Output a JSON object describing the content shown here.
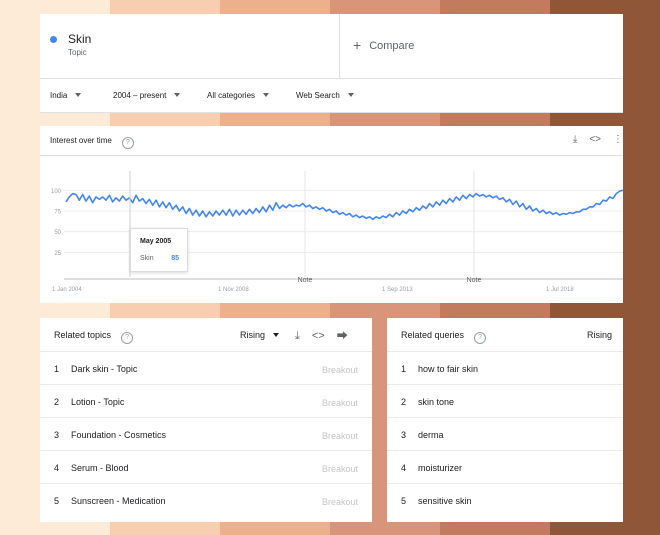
{
  "colors": {
    "accent": "#4285f4",
    "bands": [
      "#fdebd7",
      "#f8ceb0",
      "#ecb08d",
      "#d8957a",
      "#c37b60",
      "#8f5638"
    ]
  },
  "header": {
    "term_name": "Skin",
    "term_type": "Topic",
    "compare_label": "Compare",
    "compare_icon": "plus-icon"
  },
  "filters": {
    "region": "India",
    "period": "2004 – present",
    "category": "All categories",
    "search_type": "Web Search"
  },
  "interest": {
    "title": "Interest over time",
    "help_icon": "question-circle-icon",
    "icons": [
      "download-icon",
      "embed-code-icon",
      "more-icon"
    ],
    "chart_data": {
      "type": "line",
      "title": "Interest over time",
      "y_ticks": [
        100,
        75,
        50,
        25
      ],
      "ylim": [
        0,
        100
      ],
      "x_tick_labels": [
        "1 Jan 2004",
        "1 Nov 2008",
        "1 Sep 2013",
        "1 Jul 2018"
      ],
      "annotations": [
        "Note",
        "Note"
      ],
      "grid": true,
      "series": [
        {
          "name": "Skin",
          "color": "#4285f4",
          "values": [
            86,
            92,
            96,
            95,
            88,
            95,
            87,
            93,
            85,
            92,
            89,
            92,
            88,
            94,
            86,
            91,
            87,
            93,
            88,
            91,
            85,
            94,
            87,
            90,
            84,
            89,
            82,
            88,
            80,
            86,
            79,
            85,
            77,
            82,
            75,
            80,
            72,
            78,
            70,
            76,
            69,
            75,
            68,
            74,
            69,
            75,
            70,
            76,
            70,
            77,
            69,
            76,
            70,
            76,
            71,
            77,
            72,
            78,
            73,
            80,
            74,
            82,
            76,
            85,
            78,
            82,
            79,
            83,
            80,
            82,
            81,
            84,
            80,
            82,
            78,
            80,
            77,
            79,
            75,
            77,
            73,
            75,
            71,
            73,
            70,
            72,
            68,
            70,
            67,
            69,
            66,
            68,
            65,
            68,
            66,
            69,
            67,
            71,
            68,
            73,
            70,
            75,
            72,
            77,
            74,
            79,
            76,
            81,
            78,
            84,
            80,
            86,
            82,
            88,
            84,
            90,
            86,
            92,
            88,
            94,
            90,
            95,
            92,
            96,
            93,
            95,
            92,
            94,
            91,
            93,
            89,
            91,
            86,
            89,
            83,
            87,
            80,
            84,
            77,
            81,
            75,
            78,
            73,
            76,
            72,
            74,
            71,
            73,
            70,
            72,
            71,
            73,
            72,
            74,
            74,
            77,
            77,
            80,
            80,
            84,
            83,
            88,
            87,
            92,
            90,
            96,
            99,
            102
          ]
        }
      ]
    },
    "tooltip": {
      "date": "May 2005",
      "term": "Skin",
      "value": "85"
    }
  },
  "related_topics": {
    "title": "Related topics",
    "sort": "Rising",
    "icons": [
      "download-icon",
      "embed-code-icon",
      "share-icon"
    ],
    "rows": [
      {
        "rank": "1",
        "label": "Dark skin - Topic",
        "value": "Breakout"
      },
      {
        "rank": "2",
        "label": "Lotion - Topic",
        "value": "Breakout"
      },
      {
        "rank": "3",
        "label": "Foundation - Cosmetics",
        "value": "Breakout"
      },
      {
        "rank": "4",
        "label": "Serum - Blood",
        "value": "Breakout"
      },
      {
        "rank": "5",
        "label": "Sunscreen - Medication",
        "value": "Breakout"
      }
    ]
  },
  "related_queries": {
    "title": "Related queries",
    "sort": "Rising",
    "rows": [
      {
        "rank": "1",
        "label": "how to fair skin"
      },
      {
        "rank": "2",
        "label": "skin tone"
      },
      {
        "rank": "3",
        "label": "derma"
      },
      {
        "rank": "4",
        "label": "moisturizer"
      },
      {
        "rank": "5",
        "label": "sensitive skin"
      }
    ]
  }
}
